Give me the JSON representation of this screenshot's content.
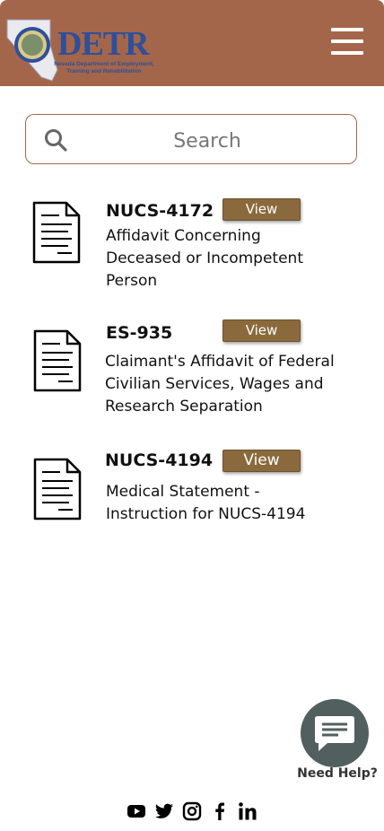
{
  "header": {
    "logo_title": "DETR",
    "logo_subtitle_line1": "Nevada Department of Employment,",
    "logo_subtitle_line2": "Training and Rehabilitation",
    "brand_color": "#a4664a",
    "menu_icon": "hamburger-menu-icon"
  },
  "search": {
    "placeholder": "Search",
    "value": "",
    "icon": "search-icon"
  },
  "documents": [
    {
      "code": "NUCS-4172",
      "view_label": "View",
      "description_lines": [
        "Affidavit Concerning",
        "Deceased or Incompetent",
        "Person"
      ]
    },
    {
      "code": "ES-935",
      "view_label": "View",
      "description_lines": [
        "Claimant's Affidavit of Federal",
        "Civilian Services, Wages and",
        "Research Separation"
      ]
    },
    {
      "code": "NUCS-4194",
      "view_label": "View",
      "description_lines": [
        "Medical Statement -",
        "Instruction for NUCS-4194"
      ]
    }
  ],
  "help": {
    "label": "Need Help?",
    "icon": "chat-bubble-icon"
  },
  "social": [
    {
      "icon": "youtube-icon"
    },
    {
      "icon": "twitter-icon"
    },
    {
      "icon": "instagram-icon"
    },
    {
      "icon": "facebook-icon"
    },
    {
      "icon": "linkedin-icon"
    }
  ],
  "colors": {
    "header": "#a4664a",
    "view_button": "#8a6a3c",
    "help_button": "#525f5f"
  }
}
